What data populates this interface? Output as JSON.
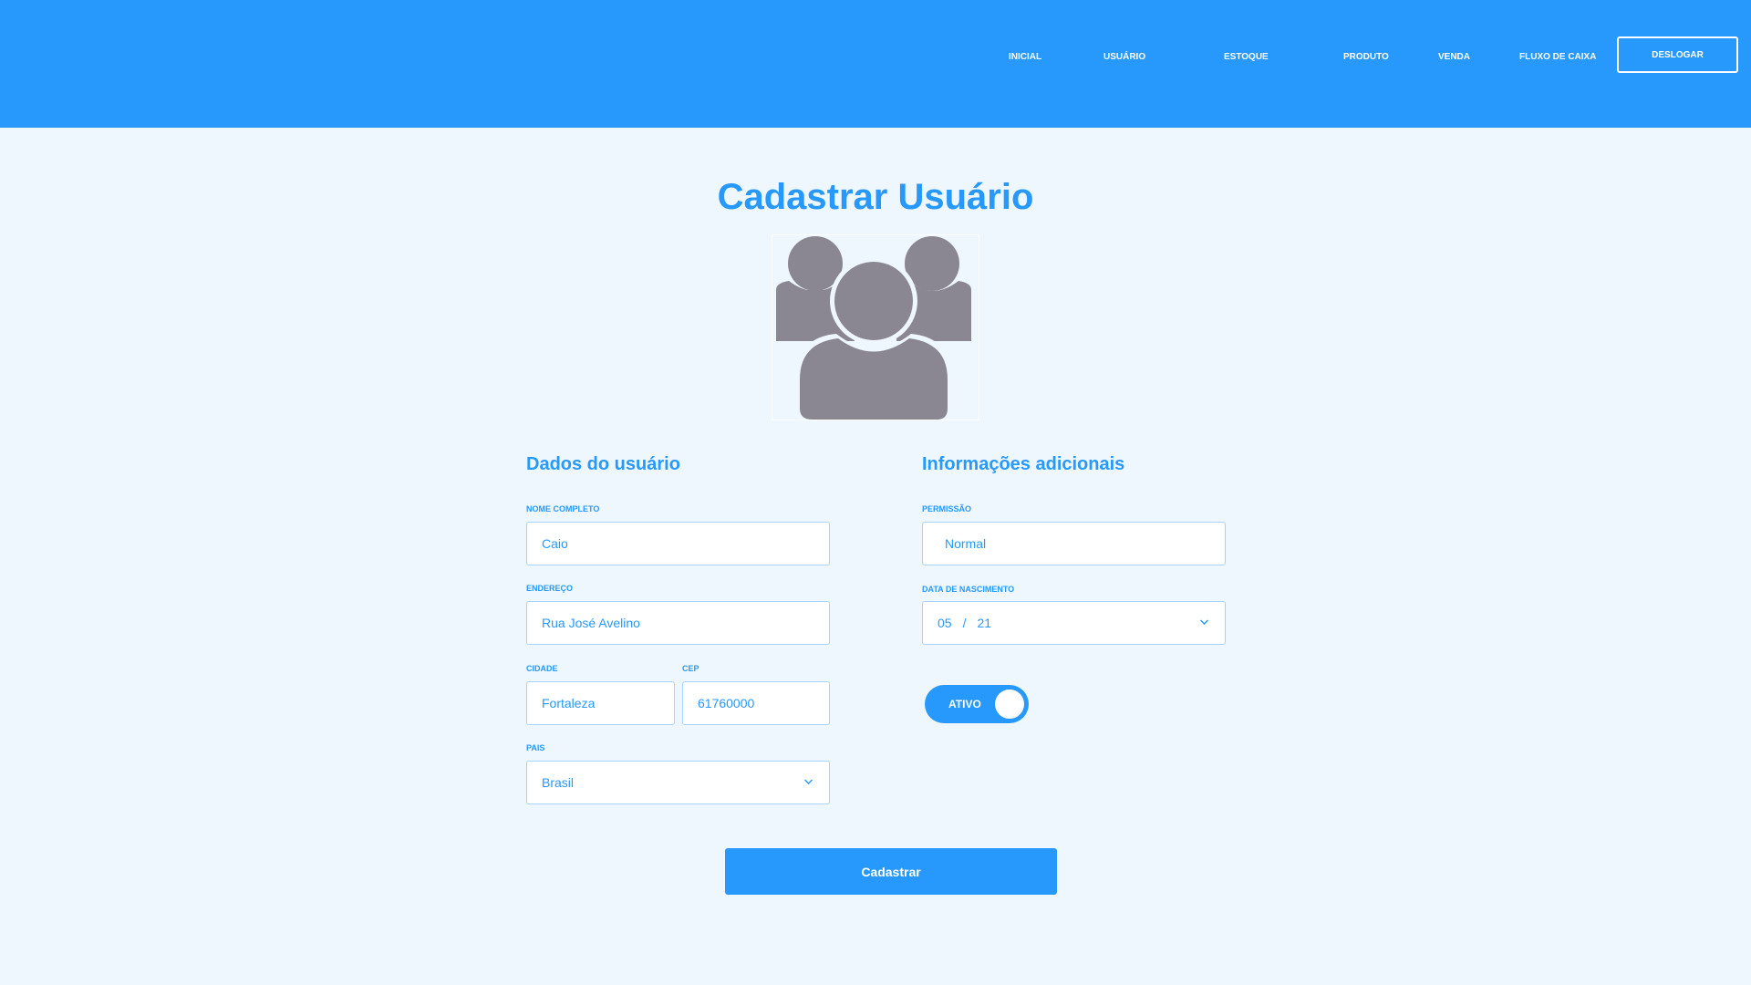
{
  "nav": {
    "items": [
      {
        "label": "INICIAL"
      },
      {
        "label": "USUÁRIO"
      },
      {
        "label": "ESTOQUE"
      },
      {
        "label": "PRODUTO"
      },
      {
        "label": "VENDA"
      },
      {
        "label": "FLUXO DE CAIXA"
      }
    ],
    "logout_label": "DESLOGAR"
  },
  "page": {
    "title": "Cadastrar Usuário",
    "avatar_icon": "users-group-icon"
  },
  "user_data": {
    "section_title": "Dados do usuário",
    "full_name": {
      "label": "NOME COMPLETO",
      "value": "Caio"
    },
    "address": {
      "label": "ENDEREÇO",
      "value": "Rua José Avelino"
    },
    "city": {
      "label": "CIDADE",
      "value": "Fortaleza"
    },
    "zip": {
      "label": "CEP",
      "value": "61760000"
    },
    "country": {
      "label": "PAIS",
      "value": "Brasil"
    }
  },
  "additional": {
    "section_title": "Informações adicionais",
    "permission": {
      "label": "PERMISSÃO",
      "value": "Normal"
    },
    "birth_date": {
      "label": "DATA DE NASCIMENTO",
      "month": "05",
      "separator": "/",
      "day": "21"
    },
    "status_toggle": {
      "label": "ATIVO",
      "on": true
    }
  },
  "form": {
    "submit_label": "Cadastrar"
  },
  "colors": {
    "accent": "#2799fc",
    "background": "#eff7fe",
    "icon_gray": "#8a8793"
  }
}
